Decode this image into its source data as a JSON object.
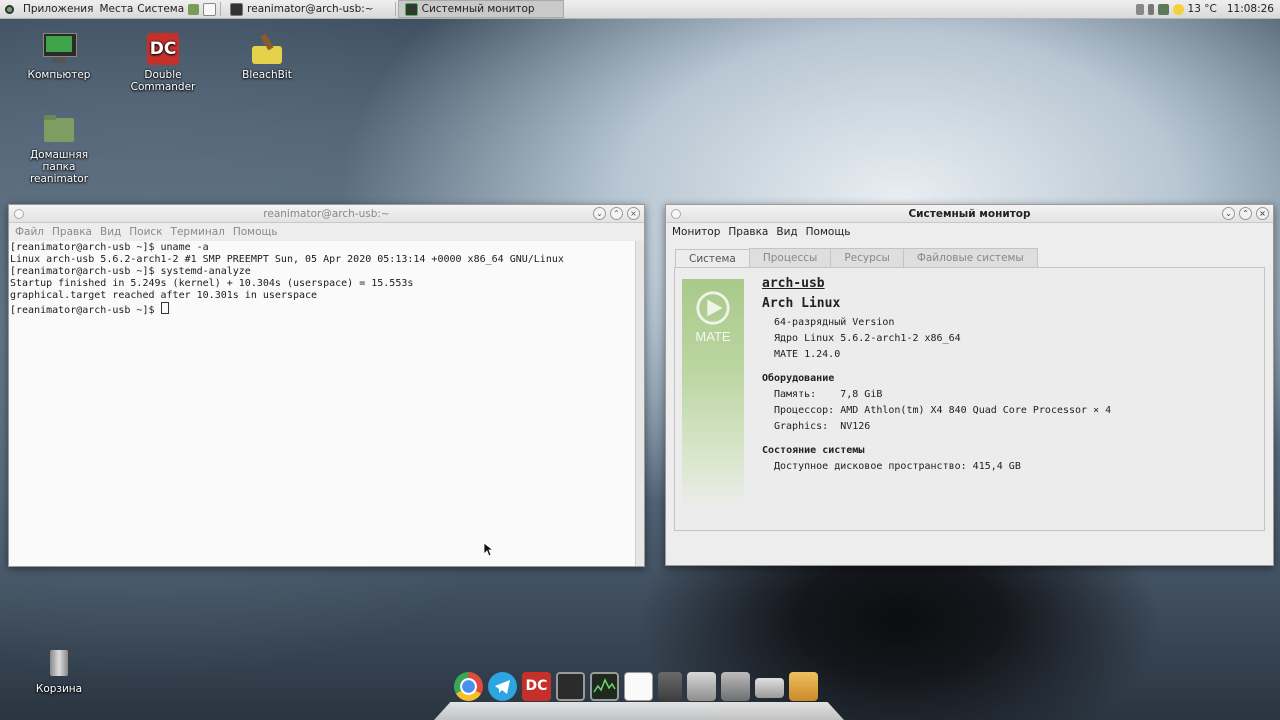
{
  "top_panel": {
    "menus": [
      "Приложения",
      "Места",
      "Система"
    ],
    "tasks": [
      {
        "label": "reanimator@arch-usb:~",
        "icon": "terminal-icon",
        "active": false
      },
      {
        "label": "Системный монитор",
        "icon": "system-monitor-icon",
        "active": true
      }
    ],
    "weather": "13 °C",
    "clock": "11:08:26"
  },
  "desktop": {
    "icons": [
      {
        "label": "Компьютер",
        "icon": "computer-icon"
      },
      {
        "label": "Double Commander",
        "icon": "double-commander-icon"
      },
      {
        "label": "BleachBit",
        "icon": "bleachbit-icon"
      },
      {
        "label": "Домашняя папка reanimator",
        "icon": "home-folder-icon"
      },
      {
        "label": "Корзина",
        "icon": "trash-icon"
      }
    ]
  },
  "terminal": {
    "title": "reanimator@arch-usb:~",
    "menu": [
      "Файл",
      "Правка",
      "Вид",
      "Поиск",
      "Терминал",
      "Помощь"
    ],
    "lines": [
      "[reanimator@arch-usb ~]$ uname -a",
      "Linux arch-usb 5.6.2-arch1-2 #1 SMP PREEMPT Sun, 05 Apr 2020 05:13:14 +0000 x86_64 GNU/Linux",
      "[reanimator@arch-usb ~]$ systemd-analyze",
      "Startup finished in 5.249s (kernel) + 10.304s (userspace) = 15.553s",
      "graphical.target reached after 10.301s in userspace"
    ],
    "prompt": "[reanimator@arch-usb ~]$ "
  },
  "sysmon": {
    "title": "Системный монитор",
    "menu": [
      "Монитор",
      "Правка",
      "Вид",
      "Помощь"
    ],
    "tabs": [
      "Система",
      "Процессы",
      "Ресурсы",
      "Файловые системы"
    ],
    "logo_text": "MATE",
    "hostname": "arch-usb",
    "distro": "Arch Linux",
    "version": "64-разрядный Version",
    "kernel": "Ядро Linux 5.6.2-arch1-2 x86_64",
    "mate": "MATE 1.24.0",
    "hardware_title": "Оборудование",
    "memory": "Память:    7,8 GiB",
    "cpu": "Процессор: AMD Athlon(tm) X4 840 Quad Core Processor × 4",
    "graphics": "Graphics:  NV126",
    "status_title": "Состояние системы",
    "disk": "Доступное дисковое пространство: 415,4 GB"
  },
  "dock": {
    "items": [
      "chromium-icon",
      "telegram-icon",
      "double-commander-icon",
      "terminal-icon",
      "system-monitor-icon",
      "text-editor-icon",
      "calculator-icon",
      "screenshot-icon",
      "disk-usage-icon",
      "disks-icon",
      "package-icon"
    ]
  }
}
